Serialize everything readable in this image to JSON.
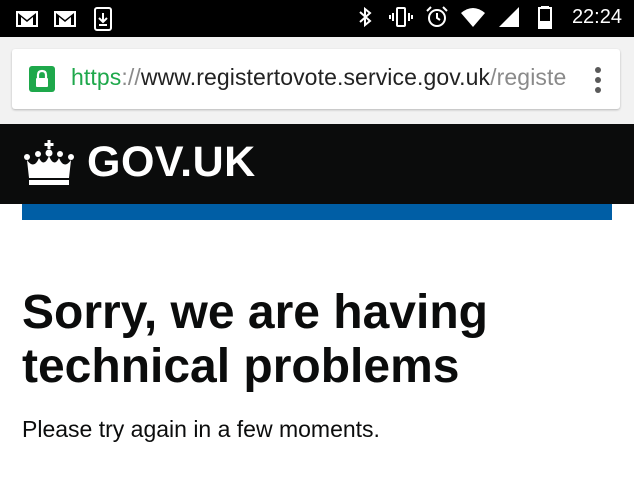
{
  "status_bar": {
    "left_icons": [
      "gmail-icon",
      "gmail-icon",
      "download-icon"
    ],
    "right_icons": [
      "bluetooth-icon",
      "vibrate-icon",
      "alarm-icon",
      "wifi-icon",
      "signal-icon",
      "battery-icon"
    ],
    "time": "22:24"
  },
  "browser": {
    "url_scheme": "https",
    "url_separator": "://",
    "url_host": "www.registertovote.service.gov.uk",
    "url_path": "/registe",
    "secure_color": "#1ea84b"
  },
  "govuk_header": {
    "logotype": "GOV.UK",
    "background": "#0b0c0c",
    "accent_bar_color": "#005ea5"
  },
  "content": {
    "heading": "Sorry, we are having technical problems",
    "body": "Please try again in a few moments."
  }
}
